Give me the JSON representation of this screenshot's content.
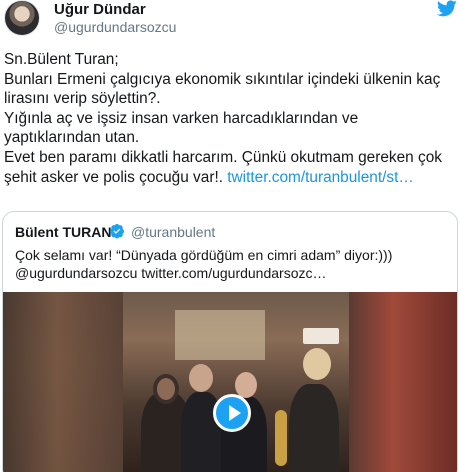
{
  "author": {
    "name": "Uğur Dündar",
    "handle": "@ugurdundarsozcu"
  },
  "tweet": {
    "text": "Sn.Bülent Turan;\nBunları Ermeni çalgıcıya ekonomik sıkıntılar içindeki ülkenin kaç lirasını verip söylettin?.\nYığınla aç ve işsiz insan varken harcadıklarından ve yaptıklarından utan.\nEvet ben paramı dikkatli harcarım. Çünkü okutmam gereken çok şehit asker ve polis çocuğu var!. ",
    "link": "twitter.com/turanbulent/st…"
  },
  "quoted_tweet": {
    "name": "Bülent TURAN",
    "handle": "@turanbulent",
    "text": "Çok selamı var! “Dünyada gördüğüm en cimri adam” diyor:)))\n@ugurdundarsozcu twitter.com/ugurdundarsozc…"
  },
  "icons": {
    "bird": "twitter-bird-icon",
    "verified": "verified-badge-icon",
    "play": "play-icon"
  },
  "colors": {
    "link": "#1b95e0",
    "twitter_blue": "#1da1f2",
    "secondary_text": "#657786"
  }
}
